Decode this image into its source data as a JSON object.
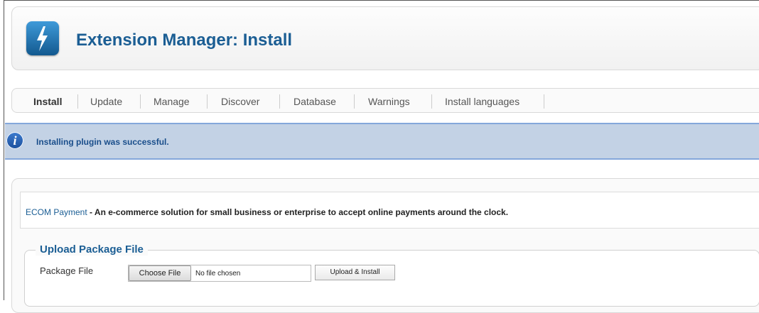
{
  "header": {
    "title": "Extension Manager: Install",
    "logo_icon": "lightning-bolt-icon"
  },
  "tabs": [
    {
      "label": "Install",
      "active": true
    },
    {
      "label": "Update",
      "active": false
    },
    {
      "label": "Manage",
      "active": false
    },
    {
      "label": "Discover",
      "active": false
    },
    {
      "label": "Database",
      "active": false
    },
    {
      "label": "Warnings",
      "active": false
    },
    {
      "label": "Install languages",
      "active": false
    }
  ],
  "message": {
    "text": "Installing plugin was successful.",
    "icon": "info-icon"
  },
  "description": {
    "name": "ECOM Payment",
    "rest": " - An e-commerce solution for small business or enterprise to accept online payments around the clock."
  },
  "upload": {
    "legend": "Upload Package File",
    "field_label": "Package File",
    "choose_label": "Choose File",
    "no_file": "No file chosen",
    "submit_label": "Upload & Install"
  },
  "colors": {
    "title": "#1b5e94",
    "message_bg": "#c3d2e5",
    "message_border": "#84a7db",
    "message_text": "#1a4e8b"
  }
}
